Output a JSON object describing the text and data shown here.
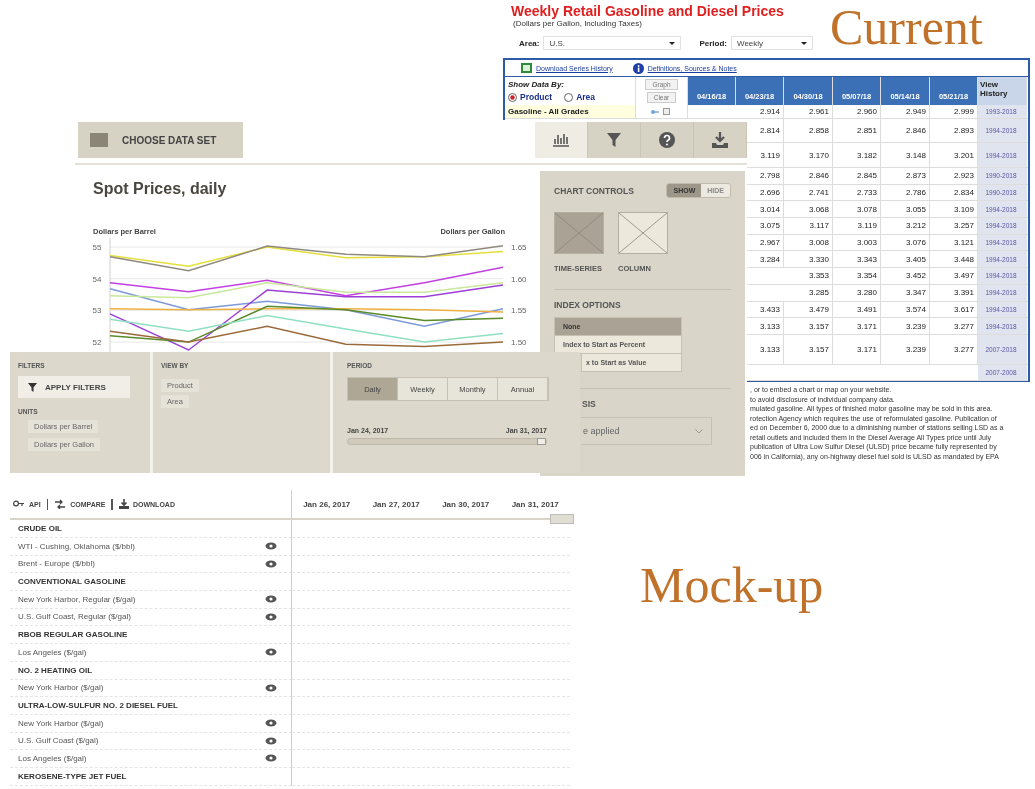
{
  "labels": {
    "current": "Current",
    "mockup": "Mock-up"
  },
  "current": {
    "title": "Weekly Retail Gasoline and Diesel Prices",
    "subtitle": "(Dollars per Gallon, Including Taxes)",
    "selects": [
      {
        "label": "Area:",
        "value": "U.S."
      },
      {
        "label": "Period:",
        "value": "Weekly"
      }
    ],
    "links": [
      {
        "kind": "excel",
        "label": "Download Series History"
      },
      {
        "kind": "info",
        "label": "Definitions, Sources & Notes"
      }
    ],
    "show_data_by": {
      "label": "Show Data By:",
      "options": [
        {
          "label": "Product",
          "selected": true
        },
        {
          "label": "Area",
          "selected": false
        }
      ]
    },
    "buttons": [
      "Graph",
      "Clear"
    ],
    "columns": [
      "04/16/18",
      "04/23/18",
      "04/30/18",
      "05/07/18",
      "05/14/18",
      "05/21/18",
      "View History"
    ],
    "rows": [
      {
        "label": "Gasoline - All Grades",
        "values": [
          "2.914",
          "2.961",
          "2.960",
          "2.949",
          "2.999"
        ],
        "history": "1993-2018"
      },
      {
        "values": [
          "2.814",
          "2.858",
          "2.851",
          "2.846",
          "2.893"
        ],
        "history": "1994-2018"
      },
      {
        "values": [
          "3.119",
          "3.170",
          "3.182",
          "3.148",
          "3.201"
        ],
        "history": "1994-2018"
      },
      {
        "values": [
          "2.798",
          "2.846",
          "2.845",
          "2.873",
          "2.923"
        ],
        "history": "1990-2018"
      },
      {
        "values": [
          "2.696",
          "2.741",
          "2.733",
          "2.786",
          "2.834"
        ],
        "history": "1990-2018"
      },
      {
        "values": [
          "3.014",
          "3.068",
          "3.078",
          "3.055",
          "3.109"
        ],
        "history": "1994-2018"
      },
      {
        "values": [
          "3.075",
          "3.117",
          "3.119",
          "3.212",
          "3.257"
        ],
        "history": "1994-2018"
      },
      {
        "values": [
          "2.967",
          "3.008",
          "3.003",
          "3.076",
          "3.121"
        ],
        "history": "1994-2018"
      },
      {
        "values": [
          "3.284",
          "3.330",
          "3.343",
          "3.405",
          "3.448"
        ],
        "history": "1994-2018"
      },
      {
        "values": [
          "3.353",
          "3.354",
          "3.452",
          "3.497"
        ],
        "history": "1994-2018"
      },
      {
        "values": [
          "3.285",
          "3.280",
          "3.347",
          "3.391"
        ],
        "history": "1994-2018"
      },
      {
        "values": [
          "3.433",
          "3.479",
          "3.491",
          "3.574",
          "3.617"
        ],
        "history": "1994-2018"
      },
      {
        "values": [
          "3.133",
          "3.157",
          "3.171",
          "3.239",
          "3.277"
        ],
        "history": "1994-2018"
      },
      {
        "values": [
          "3.133",
          "3.157",
          "3.171",
          "3.239",
          "3.277"
        ],
        "history": "2007-2018"
      },
      {
        "history": "2007-2008"
      }
    ],
    "notes": [
      ", or to embed a chart or map on your website.",
      "to avoid disclosure of individual company data.",
      "mulated gasoline. All types of finished motor gasoline may be sold in this area.",
      "rotection Agency which requires the use of reformulated gasoline. Publication of",
      "ed on December 6, 2000 due to a diminishing number of stations selling LSD as a",
      "retail outlets and included them in the Diesel Average All Types price until July",
      "publication of Ultra Low Sulfur Diesel (ULSD) price became fully represented by",
      "006 in California), any on-highway diesel fuel sold is ULSD as mandated by EPA"
    ]
  },
  "mockup_top": {
    "choose_button": "CHOOSE DATA SET",
    "tools": [
      {
        "kind": "chart",
        "selected": true
      },
      {
        "kind": "filter",
        "selected": false
      },
      {
        "kind": "help",
        "selected": false
      },
      {
        "kind": "download",
        "selected": false
      }
    ],
    "chart": {
      "title": "Spot Prices, daily",
      "right_label": "Dollars per Gallon",
      "right_ticks": [
        "1.65",
        "1.60",
        "1.55",
        "1.50"
      ],
      "chart_data": {
        "type": "line",
        "ylabel": "Dollars per Barrel",
        "yticks": [
          52,
          53,
          54,
          55
        ],
        "ylim": [
          51.7,
          55.3
        ],
        "grid": true,
        "series": [
          {
            "color": "#e6df3a",
            "values": [
              54.73,
              54.39,
              55.0,
              54.66,
              54.69,
              54.86
            ]
          },
          {
            "color": "#8f8a80",
            "values": [
              54.69,
              54.25,
              55.03,
              54.77,
              54.69,
              55.04
            ]
          },
          {
            "color": "#c23fe0",
            "values": [
              53.87,
              53.59,
              53.95,
              53.46,
              53.87,
              54.36
            ]
          },
          {
            "color": "#7d9ad8",
            "values": [
              53.68,
              53.02,
              53.29,
              53.02,
              52.5,
              53.05
            ]
          },
          {
            "color": "#c8e89a",
            "values": [
              53.46,
              53.4,
              53.87,
              53.57,
              53.57,
              53.87
            ]
          },
          {
            "color": "#9b3fd6",
            "values": [
              52.89,
              51.75,
              53.64,
              53.43,
              53.43,
              53.8
            ]
          },
          {
            "color": "#f0b040",
            "values": [
              53.05,
              53.02,
              53.05,
              53.05,
              53.02,
              52.95
            ]
          },
          {
            "color": "#5a8a2a",
            "values": [
              52.2,
              52.0,
              53.13,
              53.02,
              52.68,
              52.75
            ]
          },
          {
            "color": "#8fe0c0",
            "values": [
              52.72,
              52.34,
              52.84,
              52.41,
              52.0,
              52.27
            ]
          },
          {
            "color": "#9a6a3a",
            "values": [
              52.34,
              52.0,
              52.5,
              51.93,
              51.86,
              52.0
            ]
          }
        ]
      }
    },
    "controls": {
      "title": "CHART CONTROLS",
      "toggle": [
        {
          "label": "SHOW",
          "selected": true
        },
        {
          "label": "HIDE",
          "selected": false
        }
      ],
      "chart_types": [
        {
          "label": "TIME-SERIES",
          "selected": true
        },
        {
          "label": "COLUMN",
          "selected": false
        }
      ],
      "index_title": "INDEX OPTIONS",
      "index_options": [
        {
          "label": "None",
          "selected": true
        },
        {
          "label": "Index to Start as Percent",
          "selected": false
        },
        {
          "label": "x to Start as Value",
          "selected": false
        }
      ],
      "analysis_title": "SIS",
      "analysis_value": "e applied"
    }
  },
  "mockup_filters": {
    "filters_title": "FILTERS",
    "apply_button": "APPLY FILTERS",
    "units_title": "UNITS",
    "units": [
      "Dollars per Barrel",
      "Dollars per Gallon"
    ],
    "view_by_title": "VIEW BY",
    "view_by": [
      "Product",
      "Area"
    ],
    "period_title": "PERIOD",
    "periods": [
      {
        "label": "Daily",
        "selected": true
      },
      {
        "label": "Weekly",
        "selected": false
      },
      {
        "label": "Monthly",
        "selected": false
      },
      {
        "label": "Annual",
        "selected": false
      }
    ],
    "range_start": "Jan 24, 2017",
    "range_end": "Jan 31, 2017",
    "range": {
      "level": 1
    }
  },
  "mockup_table": {
    "tools": [
      {
        "kind": "key",
        "label": "API"
      },
      {
        "kind": "compare",
        "label": "COMPARE"
      },
      {
        "kind": "download",
        "label": "DOWNLOAD"
      }
    ],
    "dates": [
      "Jan 26, 2017",
      "Jan 27, 2017",
      "Jan 30, 2017",
      "Jan 31, 2017"
    ],
    "groups": [
      {
        "title": "CRUDE OIL",
        "items": [
          "WTI - Cushing, Oklahoma ($/bbl)",
          "Brent - Europe ($/bbl)"
        ]
      },
      {
        "title": "CONVENTIONAL GASOLINE",
        "items": [
          "New York Harbor, Regular ($/gal)",
          "U.S. Gulf Coast, Regular ($/gal)"
        ]
      },
      {
        "title": "RBOB REGULAR GASOLINE",
        "items": [
          "Los Angeles ($/gal)"
        ]
      },
      {
        "title": "NO. 2 HEATING OIL",
        "items": [
          "New York Harbor ($/gal)"
        ]
      },
      {
        "title": "ULTRA-LOW-SULFUR NO. 2 DIESEL FUEL",
        "items": [
          "New York Harbor ($/gal)",
          "U.S. Gulf Coast ($/gal)",
          "Los Angeles ($/gal)"
        ]
      },
      {
        "title": "KEROSENE-TYPE JET FUEL"
      }
    ]
  }
}
